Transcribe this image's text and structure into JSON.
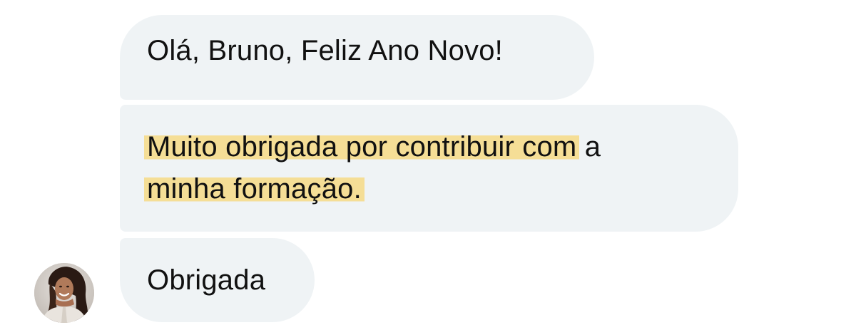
{
  "conversation": {
    "messages": [
      {
        "lines": [
          {
            "highlighted": "",
            "plain": "Olá, Bruno, Feliz Ano Novo!"
          }
        ]
      },
      {
        "lines": [
          {
            "highlighted": "Muito obrigada por contribuir com",
            "plain": " a"
          },
          {
            "highlighted": "minha formação.",
            "plain": ""
          }
        ]
      },
      {
        "lines": [
          {
            "highlighted": "",
            "plain": "Obrigada"
          }
        ]
      }
    ],
    "sender_avatar": "avatar-photo"
  },
  "colors": {
    "bubble_background": "#eff3f5",
    "highlight": "#f5de96",
    "text": "#111111"
  }
}
